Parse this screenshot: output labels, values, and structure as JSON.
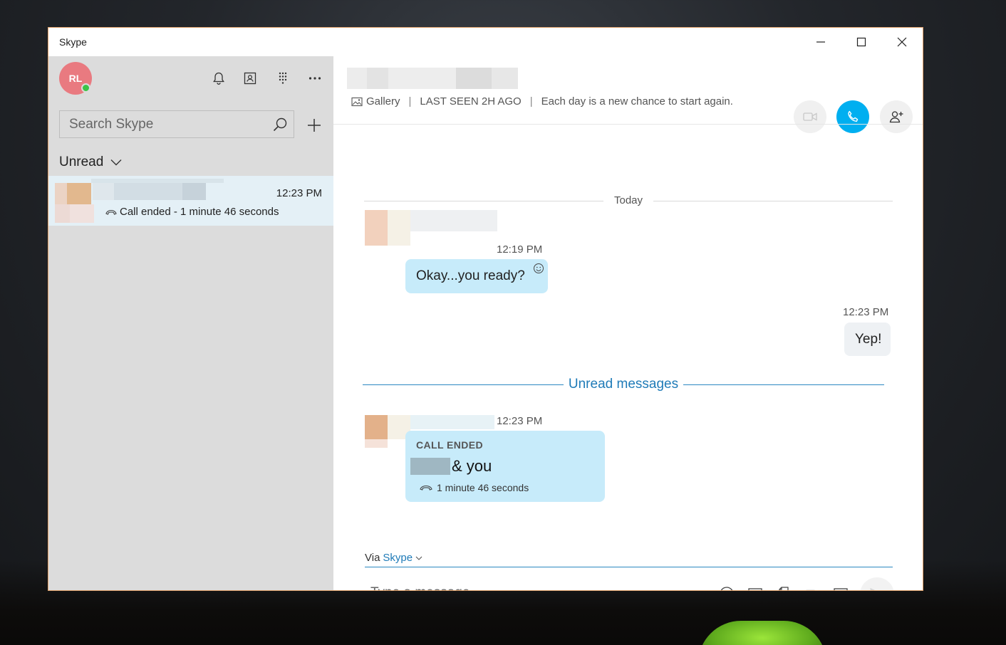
{
  "window": {
    "title": "Skype"
  },
  "profile": {
    "initials": "RL",
    "presence": "online"
  },
  "sidebar": {
    "search": {
      "placeholder": "Search Skype"
    },
    "filter_label": "Unread",
    "chats": [
      {
        "time": "12:23 PM",
        "preview": "Call ended - 1 minute 46 seconds"
      }
    ]
  },
  "conversation": {
    "header": {
      "gallery_label": "Gallery",
      "last_seen": "LAST SEEN 2H AGO",
      "mood": "Each day is a new chance to start again."
    },
    "date_separator": "Today",
    "messages": [
      {
        "time": "12:19 PM",
        "text": "Okay...you ready?"
      },
      {
        "time": "12:23 PM",
        "text": "Yep!"
      }
    ],
    "unread_separator": "Unread messages",
    "call": {
      "time": "12:23 PM",
      "label": "CALL ENDED",
      "participants": "& you",
      "duration": "1 minute 46 seconds"
    }
  },
  "composer": {
    "via_label": "Via",
    "via_service": "Skype",
    "placeholder": "Type a message"
  },
  "colors": {
    "accent": "#00aff0",
    "sidebar_bg": "#dcdcdc",
    "incoming_bubble": "#c7ebfa",
    "outgoing_bubble": "#eef1f4",
    "avatar": "#e97a80",
    "presence_online": "#3cc347"
  }
}
